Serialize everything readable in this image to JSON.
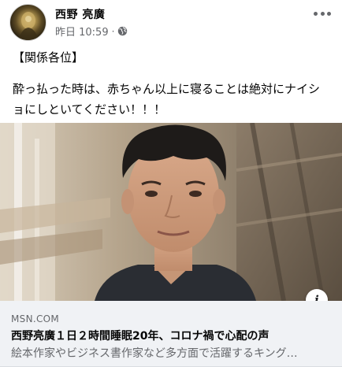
{
  "post": {
    "author": "西野 亮廣",
    "timestamp": "昨日 10:59",
    "separator": "·",
    "privacy_icon": "globe-icon",
    "more_icon": "more-horizontal-icon",
    "lines": [
      "【関係各位】",
      "酔っ払った時は、赤ちゃん以上に寝ることは絶対にナイシ",
      "ョにしといてください！！！"
    ]
  },
  "link": {
    "domain": "MSN.COM",
    "title": "西野亮廣１日２時間睡眠20年、コロナ禍で心配の声",
    "description": "絵本作家やビジネス書作家など多方面で活躍するキング…",
    "info_icon": "i"
  },
  "colors": {
    "text_primary": "#050505",
    "text_secondary": "#65676b",
    "card_background": "#f0f2f5"
  }
}
